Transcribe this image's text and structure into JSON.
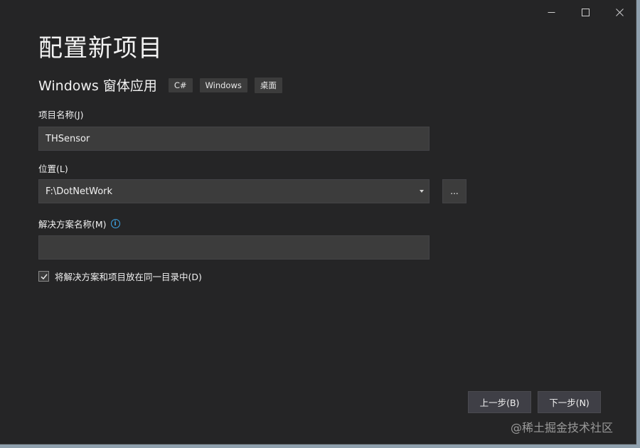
{
  "window": {
    "title": "配置新项目",
    "template_name": "Windows 窗体应用",
    "tags": [
      "C#",
      "Windows",
      "桌面"
    ]
  },
  "form": {
    "project_name_label": "项目名称(J)",
    "project_name_value": "THSensor",
    "location_label": "位置(L)",
    "location_value": "F:\\DotNetWork",
    "browse_label": "...",
    "solution_name_label": "解决方案名称(M)",
    "solution_name_value": "",
    "same_dir_checkbox_label": "将解决方案和项目放在同一目录中(D)",
    "same_dir_checked": true
  },
  "buttons": {
    "back": "上一步(B)",
    "next": "下一步(N)"
  },
  "watermark": "@稀土掘金技术社区",
  "colors": {
    "window_bg": "#252526",
    "field_bg": "#3c3c3c",
    "info_accent": "#3ea6e8"
  }
}
